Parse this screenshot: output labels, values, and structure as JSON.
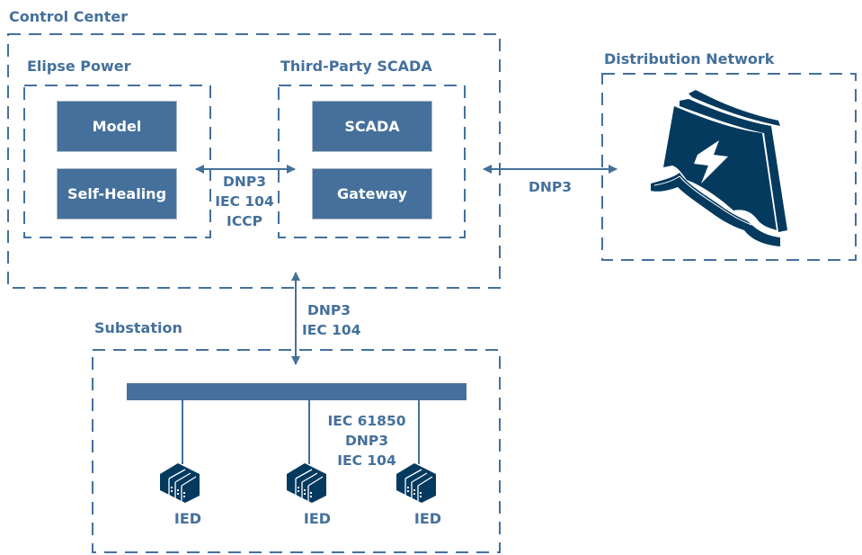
{
  "colors": {
    "accent": "#44709b",
    "icon_dark": "#053a5f",
    "text_on_box": "#ffffff"
  },
  "control_center": {
    "title": "Control Center",
    "elipse_power": {
      "title": "Elipse Power",
      "modules": [
        "Model",
        "Self-Healing"
      ]
    },
    "third_party_scada": {
      "title": "Third-Party SCADA",
      "modules": [
        "SCADA",
        "Gateway"
      ]
    },
    "link_protocols": [
      "DNP3",
      "IEC 104",
      "ICCP"
    ]
  },
  "distribution_network": {
    "title": "Distribution Network",
    "icon": "power-grid-lightning-icon",
    "link_protocols": [
      "DNP3"
    ]
  },
  "substation": {
    "title": "Substation",
    "uplink_protocols": [
      "DNP3",
      "IEC 104"
    ],
    "bus_protocols": [
      "IEC 61850",
      "DNP3",
      "IEC 104"
    ],
    "devices": [
      {
        "label": "IED",
        "icon": "ied-device-icon"
      },
      {
        "label": "IED",
        "icon": "ied-device-icon"
      },
      {
        "label": "IED",
        "icon": "ied-device-icon"
      }
    ]
  }
}
